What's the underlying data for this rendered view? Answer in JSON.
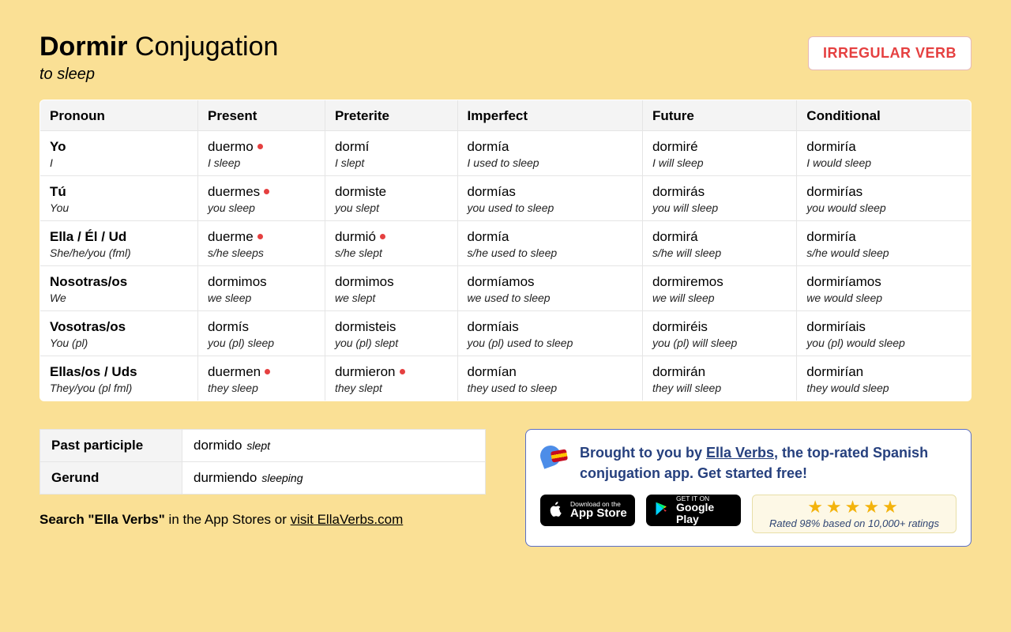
{
  "header": {
    "verb": "Dormir",
    "word_conjugation": "Conjugation",
    "translation": "to sleep",
    "badge": "IRREGULAR VERB"
  },
  "columns": [
    "Pronoun",
    "Present",
    "Preterite",
    "Imperfect",
    "Future",
    "Conditional"
  ],
  "rows": [
    {
      "pronoun": {
        "es": "Yo",
        "en": "I"
      },
      "cells": [
        {
          "es": "duermo",
          "en": "I sleep",
          "irr": true
        },
        {
          "es": "dormí",
          "en": "I slept",
          "irr": false
        },
        {
          "es": "dormía",
          "en": "I used to sleep",
          "irr": false
        },
        {
          "es": "dormiré",
          "en": "I will sleep",
          "irr": false
        },
        {
          "es": "dormiría",
          "en": "I would sleep",
          "irr": false
        }
      ]
    },
    {
      "pronoun": {
        "es": "Tú",
        "en": "You"
      },
      "cells": [
        {
          "es": "duermes",
          "en": "you sleep",
          "irr": true
        },
        {
          "es": "dormiste",
          "en": "you slept",
          "irr": false
        },
        {
          "es": "dormías",
          "en": "you used to sleep",
          "irr": false
        },
        {
          "es": "dormirás",
          "en": "you will sleep",
          "irr": false
        },
        {
          "es": "dormirías",
          "en": "you would sleep",
          "irr": false
        }
      ]
    },
    {
      "pronoun": {
        "es": "Ella / Él / Ud",
        "en": "She/he/you (fml)"
      },
      "cells": [
        {
          "es": "duerme",
          "en": "s/he sleeps",
          "irr": true
        },
        {
          "es": "durmió",
          "en": "s/he slept",
          "irr": true
        },
        {
          "es": "dormía",
          "en": "s/he used to sleep",
          "irr": false
        },
        {
          "es": "dormirá",
          "en": "s/he will sleep",
          "irr": false
        },
        {
          "es": "dormiría",
          "en": "s/he would sleep",
          "irr": false
        }
      ]
    },
    {
      "pronoun": {
        "es": "Nosotras/os",
        "en": "We"
      },
      "cells": [
        {
          "es": "dormimos",
          "en": "we sleep",
          "irr": false
        },
        {
          "es": "dormimos",
          "en": "we slept",
          "irr": false
        },
        {
          "es": "dormíamos",
          "en": "we used to sleep",
          "irr": false
        },
        {
          "es": "dormiremos",
          "en": "we will sleep",
          "irr": false
        },
        {
          "es": "dormiríamos",
          "en": "we would sleep",
          "irr": false
        }
      ]
    },
    {
      "pronoun": {
        "es": "Vosotras/os",
        "en": "You (pl)"
      },
      "cells": [
        {
          "es": "dormís",
          "en": "you (pl) sleep",
          "irr": false
        },
        {
          "es": "dormisteis",
          "en": "you (pl) slept",
          "irr": false
        },
        {
          "es": "dormíais",
          "en": "you (pl) used to sleep",
          "irr": false
        },
        {
          "es": "dormiréis",
          "en": "you (pl) will sleep",
          "irr": false
        },
        {
          "es": "dormiríais",
          "en": "you (pl) would sleep",
          "irr": false
        }
      ]
    },
    {
      "pronoun": {
        "es": "Ellas/os / Uds",
        "en": "They/you (pl fml)"
      },
      "cells": [
        {
          "es": "duermen",
          "en": "they sleep",
          "irr": true
        },
        {
          "es": "durmieron",
          "en": "they slept",
          "irr": true
        },
        {
          "es": "dormían",
          "en": "they used to sleep",
          "irr": false
        },
        {
          "es": "dormirán",
          "en": "they will sleep",
          "irr": false
        },
        {
          "es": "dormirían",
          "en": "they would sleep",
          "irr": false
        }
      ]
    }
  ],
  "participles": [
    {
      "label": "Past participle",
      "es": "dormido",
      "en": "slept"
    },
    {
      "label": "Gerund",
      "es": "durmiendo",
      "en": "sleeping"
    }
  ],
  "search_line": {
    "bold": "Search \"Ella Verbs\"",
    "rest": " in the App Stores or ",
    "link": "visit EllaVerbs.com"
  },
  "promo": {
    "text_before": "Brought to you by ",
    "link": "Ella Verbs",
    "text_after": ", the top-rated Spanish conjugation app. Get started free!",
    "appstore_sm": "Download on the",
    "appstore_lg": "App Store",
    "gplay_sm": "GET IT ON",
    "gplay_lg": "Google Play",
    "rating_text": "Rated 98% based on 10,000+ ratings"
  }
}
